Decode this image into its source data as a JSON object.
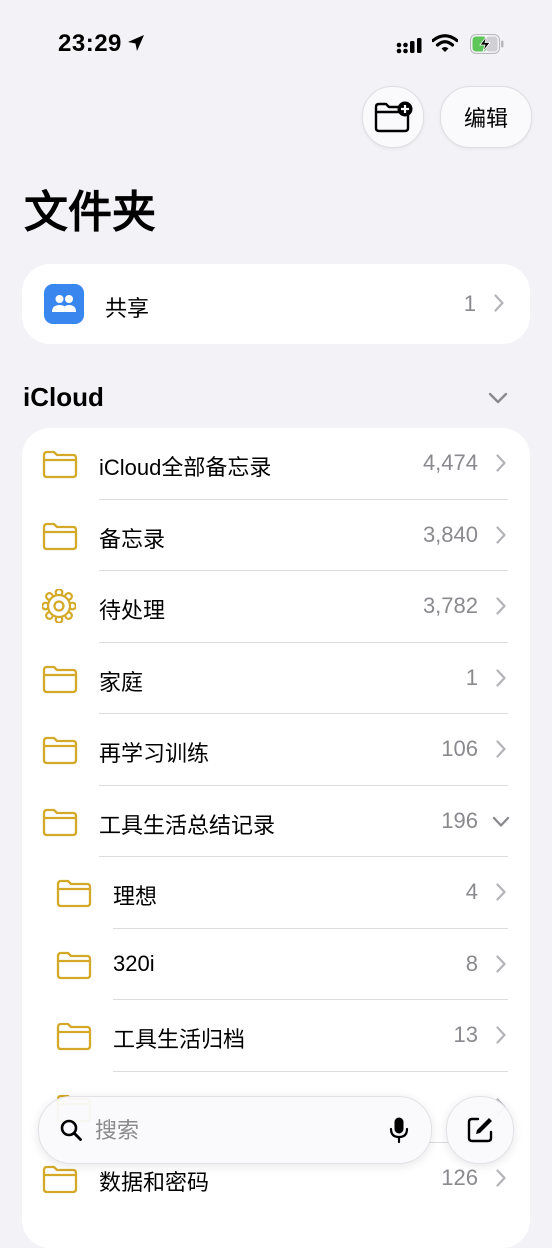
{
  "status_bar": {
    "time": "23:29"
  },
  "header": {
    "edit_label": "编辑",
    "title": "文件夹"
  },
  "shared": {
    "label": "共享",
    "count": "1"
  },
  "section": {
    "title": "iCloud"
  },
  "folders": [
    {
      "name": "iCloud全部备忘录",
      "count": "4,474",
      "icon": "folder-icon",
      "indent": false,
      "expanded": false
    },
    {
      "name": "备忘录",
      "count": "3,840",
      "icon": "folder-icon",
      "indent": false,
      "expanded": false
    },
    {
      "name": "待处理",
      "count": "3,782",
      "icon": "gear-icon",
      "indent": false,
      "expanded": false
    },
    {
      "name": "家庭",
      "count": "1",
      "icon": "folder-icon",
      "indent": false,
      "expanded": false
    },
    {
      "name": "再学习训练",
      "count": "106",
      "icon": "folder-icon",
      "indent": false,
      "expanded": false
    },
    {
      "name": "工具生活总结记录",
      "count": "196",
      "icon": "folder-icon",
      "indent": false,
      "expanded": true
    },
    {
      "name": "理想",
      "count": "4",
      "icon": "folder-icon",
      "indent": true,
      "expanded": false
    },
    {
      "name": "320i",
      "count": "8",
      "icon": "folder-icon",
      "indent": true,
      "expanded": false
    },
    {
      "name": "工具生活归档",
      "count": "13",
      "icon": "folder-icon",
      "indent": true,
      "expanded": false
    },
    {
      "name": "",
      "count": "",
      "icon": "folder-icon",
      "indent": true,
      "expanded": false
    },
    {
      "name": "数据和密码",
      "count": "126",
      "icon": "folder-icon",
      "indent": false,
      "expanded": false
    }
  ],
  "search": {
    "placeholder": "搜索"
  },
  "colors": {
    "accent_folder": "#d4a928",
    "shared_blue": "#3a86ef",
    "background": "#f2f2f7"
  }
}
